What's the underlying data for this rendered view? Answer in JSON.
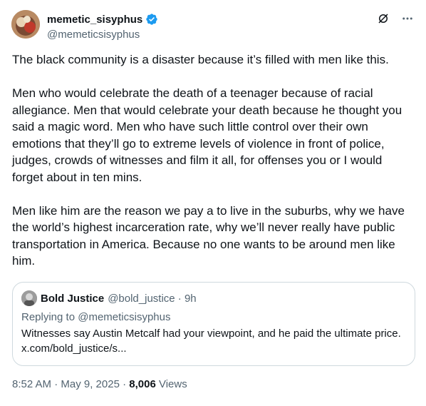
{
  "author": {
    "display_name": "memetic_sisyphus",
    "handle": "@memeticsisyphus"
  },
  "icons": {
    "verified": "verified-badge-icon",
    "grok": "grok-icon",
    "more": "more-options-icon"
  },
  "tweet": {
    "paragraphs": [
      "The black community is a disaster because it’s filled with men like this.",
      "Men who would celebrate the death of a teenager because of racial allegiance. Men that would celebrate your death because he thought you said a magic word. Men who have such little control over their own emotions that they’ll go to extreme levels of violence in front of police, judges, crowds of witnesses and film it all, for offenses you or I would forget about in ten mins.",
      "Men like him are the reason we pay a to live in the suburbs, why we have the world’s highest incarceration rate, why we’ll never really have public transportation in America. Because no one wants to be around men like him."
    ]
  },
  "quote": {
    "display_name": "Bold Justice",
    "handle_time": "@bold_justice · 9h",
    "replying_prefix": "Replying to ",
    "replying_to": "@memeticsisyphus",
    "text": "Witnesses say Austin Metcalf had your viewpoint, and he paid the ultimate price. x.com/bold_justice/s..."
  },
  "meta": {
    "timestamp": "8:52 AM · May 9, 2025 · ",
    "views_count": "8,006",
    "views_label": " Views"
  },
  "colors": {
    "verified_blue": "#1d9bf0",
    "secondary_text": "#536471",
    "border": "#cfd9de"
  }
}
